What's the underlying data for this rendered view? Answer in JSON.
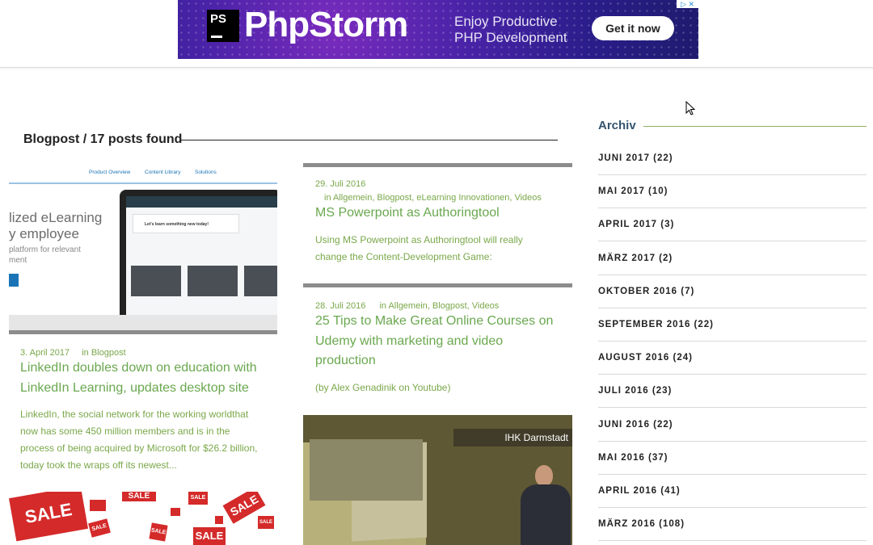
{
  "ad": {
    "logo_text": "PS",
    "brand": "PhpStorm",
    "tagline_line1": "Enjoy Productive",
    "tagline_line2": "PHP Development",
    "cta": "Get it now"
  },
  "main": {
    "heading": "Blogpost / 17 posts found"
  },
  "posts": [
    {
      "date": "29. Juli 2016",
      "categories": "in Allgemein, Blogpost, eLearning Innovationen, Videos",
      "title": "MS Powerpoint as Authoringtool",
      "excerpt_line1": "Using MS Powerpoint as Authoringtool will really",
      "excerpt_line2": "change the Content-Development Game:"
    },
    {
      "date": "28. Juli 2016",
      "categories": "in Allgemein, Blogpost, Videos",
      "title_line1": "25 Tips to Make Great Online Courses on",
      "title_line2": "Udemy with marketing and video",
      "title_line3": "production",
      "excerpt": "(by Alex Genadinik on Youtube)"
    },
    {
      "date": "3. April 2017",
      "categories": "in Blogpost",
      "title_line1": "LinkedIn doubles down on education with",
      "title_line2": "LinkedIn Learning, updates desktop site",
      "excerpt_line1": "LinkedIn, the social network for the working worldthat",
      "excerpt_line2": "now has some 450 million members and is in the",
      "excerpt_line3": "process of being acquired by Microsoft for $26.2 billion,",
      "excerpt_line4": "today took the wraps off its newest..."
    }
  ],
  "linkedin_image": {
    "nav": [
      "Product Overview",
      "Content Library",
      "Solutions"
    ],
    "hero_line1": "lized eLearning",
    "hero_line2": "y employee",
    "hero_sub1": "platform for relevant",
    "hero_sub2": "ment",
    "card_text": "Let's learn something new today!"
  },
  "video_image": {
    "caption": "IHK Darmstadt"
  },
  "sale_image": {
    "tag": "SALE"
  },
  "sidebar": {
    "archive_title": "Archiv",
    "archive": [
      "JUNI 2017 (22)",
      "MAI 2017 (10)",
      "APRIL 2017 (3)",
      "MÄRZ 2017 (2)",
      "OKTOBER 2016 (7)",
      "SEPTEMBER 2016 (22)",
      "AUGUST 2016 (24)",
      "JULI 2016 (23)",
      "JUNI 2016 (22)",
      "MAI 2016 (37)",
      "APRIL 2016 (41)",
      "MÄRZ 2016 (108)"
    ]
  },
  "colors": {
    "accent_green": "#6aa84f",
    "sidebar_title": "#35536e",
    "post_bar": "#8c8c8c"
  }
}
